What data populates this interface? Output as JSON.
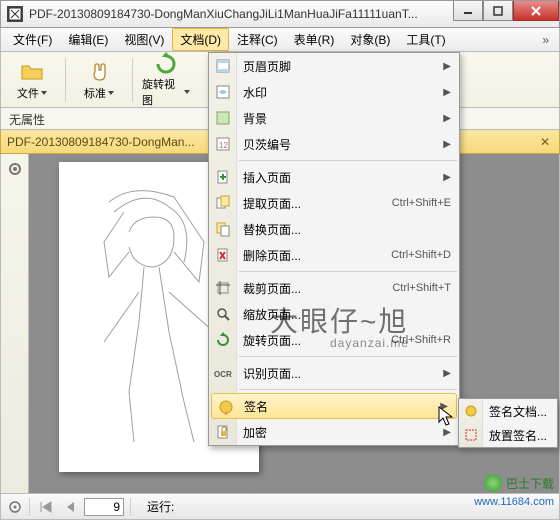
{
  "window": {
    "title": "PDF-20130809184730-DongManXiuChangJiLi1ManHuaJiFa11111uanT..."
  },
  "menubar": {
    "items": [
      {
        "label": "文件(F)"
      },
      {
        "label": "编辑(E)"
      },
      {
        "label": "视图(V)"
      },
      {
        "label": "文档(D)"
      },
      {
        "label": "注释(C)"
      },
      {
        "label": "表单(R)"
      },
      {
        "label": "对象(B)"
      },
      {
        "label": "工具(T)"
      }
    ]
  },
  "toolbar": {
    "file": "文件",
    "standard": "标准",
    "rotate": "旋转视图"
  },
  "properties": {
    "label": "无属性"
  },
  "tab": {
    "name": "PDF-20130809184730-DongMan..."
  },
  "docmenu": {
    "items": [
      {
        "icon": "header-footer-icon",
        "label": "页眉页脚",
        "sub": true
      },
      {
        "icon": "watermark-icon",
        "label": "水印",
        "sub": true
      },
      {
        "icon": "background-icon",
        "label": "背景",
        "sub": true
      },
      {
        "icon": "bates-icon",
        "label": "贝茨编号",
        "sub": true
      },
      {
        "sep": true
      },
      {
        "icon": "insert-page-icon",
        "label": "插入页面",
        "sub": true
      },
      {
        "icon": "extract-page-icon",
        "label": "提取页面...",
        "shortcut": "Ctrl+Shift+E"
      },
      {
        "icon": "replace-page-icon",
        "label": "替换页面..."
      },
      {
        "icon": "delete-page-icon",
        "label": "删除页面...",
        "shortcut": "Ctrl+Shift+D"
      },
      {
        "sep": true
      },
      {
        "icon": "crop-page-icon",
        "label": "裁剪页面...",
        "shortcut": "Ctrl+Shift+T"
      },
      {
        "icon": "zoom-page-icon",
        "label": "缩放页面..."
      },
      {
        "icon": "rotate-page-icon",
        "label": "旋转页面...",
        "shortcut": "Ctrl+Shift+R"
      },
      {
        "sep": true
      },
      {
        "icon": "ocr-icon",
        "label": "识别页面...",
        "sub": true
      },
      {
        "sep": true
      },
      {
        "icon": "sign-icon",
        "label": "签名",
        "sub": true,
        "hover": true
      },
      {
        "icon": "encrypt-icon",
        "label": "加密",
        "sub": true
      }
    ]
  },
  "submenu": {
    "items": [
      {
        "icon": "sign-doc-icon",
        "label": "签名文档..."
      },
      {
        "icon": "place-sign-icon",
        "label": "放置签名..."
      }
    ]
  },
  "status": {
    "page_input": "9",
    "run_label": "运行:"
  },
  "watermark": {
    "main": "大眼仔~旭",
    "sub": "dayanzai.me"
  },
  "corner": {
    "name": "巴士下载",
    "url": "www.11684.com"
  }
}
